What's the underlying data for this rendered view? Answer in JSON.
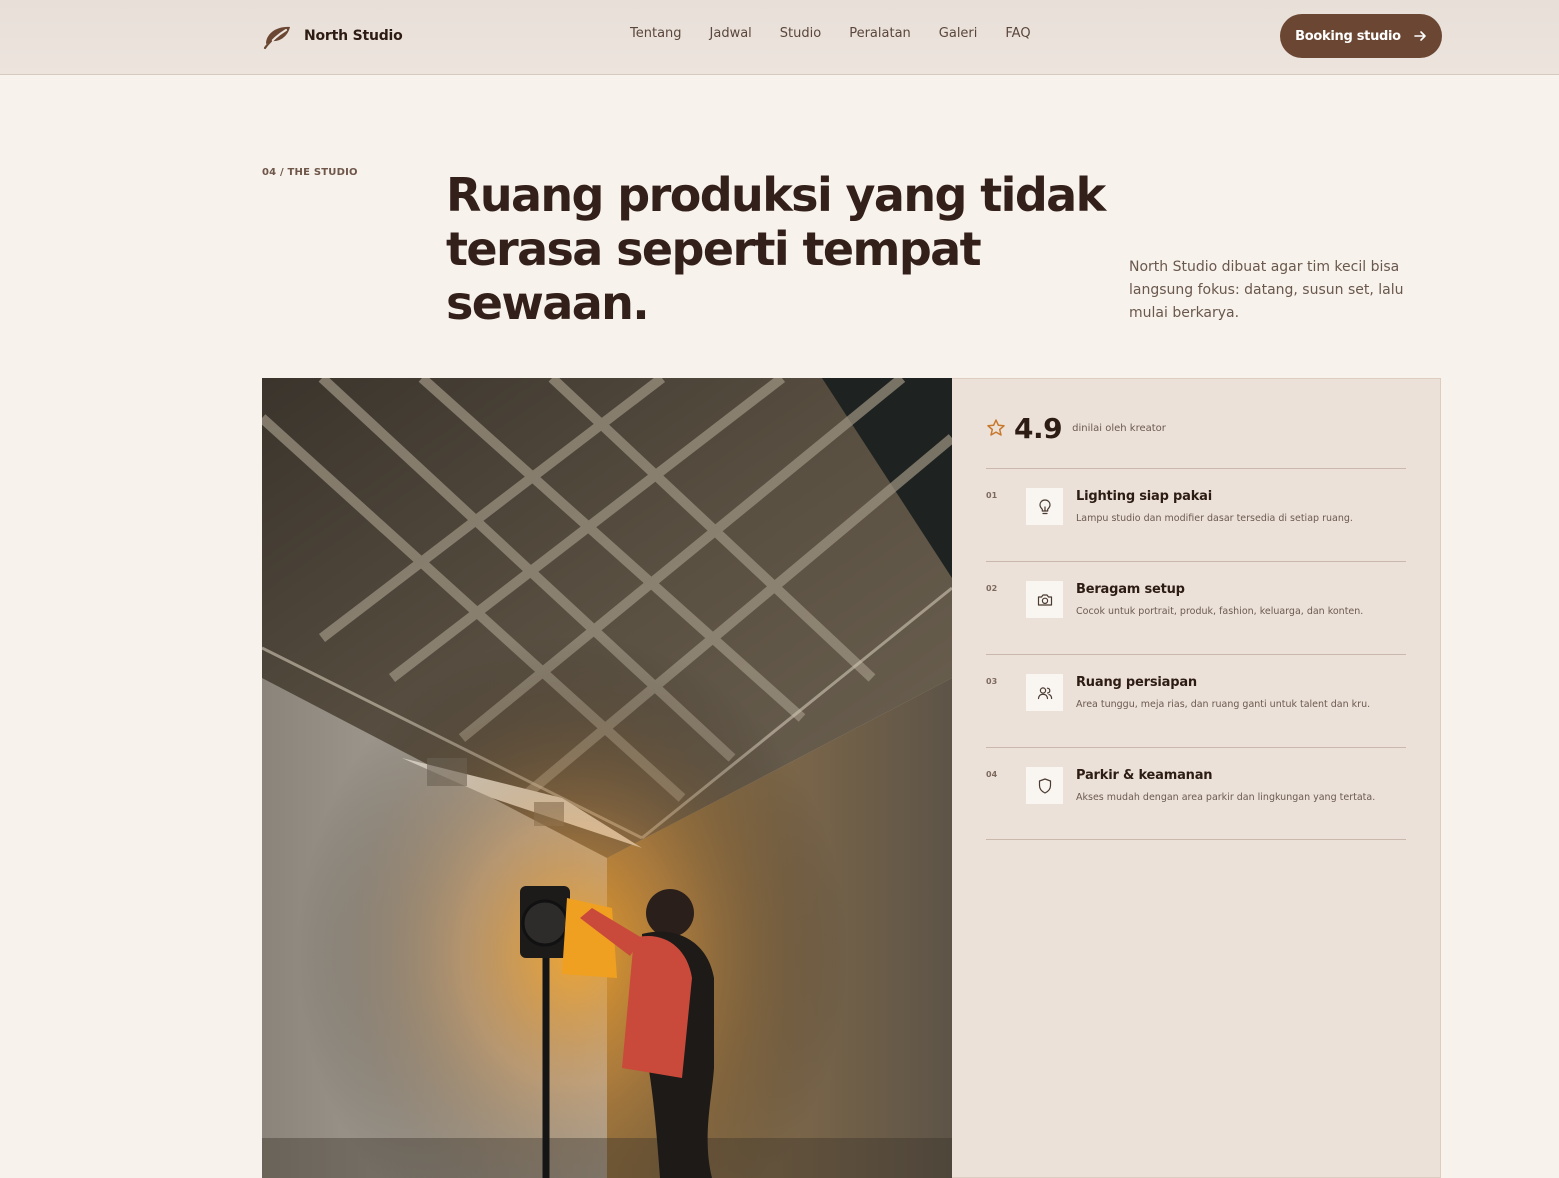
{
  "header": {
    "brand_name": "North Studio",
    "nav": [
      "Tentang",
      "Jadwal",
      "Studio",
      "Peralatan",
      "Galeri",
      "FAQ"
    ],
    "cta_label": "Booking studio"
  },
  "intro": {
    "eyebrow": "04 / THE STUDIO",
    "headline": "Ruang produksi yang tidak terasa seperti tempat sewaan.",
    "lede": "North Studio dibuat agar tim kecil bisa langsung fokus: datang, susun set, lalu mulai berkarya."
  },
  "rating": {
    "value": "4.9",
    "caption": "dinilai oleh kreator",
    "icon": "star-icon",
    "icon_color": "#c8782c"
  },
  "features": [
    {
      "num": "01",
      "icon": "lightbulb-icon",
      "title": "Lighting siap pakai",
      "desc": "Lampu studio dan modifier dasar tersedia di setiap ruang."
    },
    {
      "num": "02",
      "icon": "camera-icon",
      "title": "Beragam setup",
      "desc": "Cocok untuk portrait, produk, fashion, keluarga, dan konten."
    },
    {
      "num": "03",
      "icon": "users-icon",
      "title": "Ruang persiapan",
      "desc": "Area tunggu, meja rias, dan ruang ganti untuk talent dan kru."
    },
    {
      "num": "04",
      "icon": "shield-icon",
      "title": "Parkir & keamanan",
      "desc": "Akses mudah dengan area parkir dan lingkungan yang tertata."
    }
  ],
  "colors": {
    "accent": "#6b4632",
    "background": "#f7f2ec",
    "panel": "#ece1d8"
  }
}
